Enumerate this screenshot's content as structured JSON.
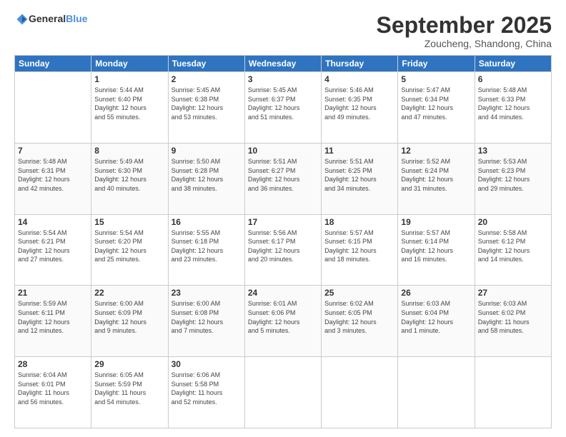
{
  "logo": {
    "text_general": "General",
    "text_blue": "Blue"
  },
  "title": "September 2025",
  "subtitle": "Zoucheng, Shandong, China",
  "days_header": [
    "Sunday",
    "Monday",
    "Tuesday",
    "Wednesday",
    "Thursday",
    "Friday",
    "Saturday"
  ],
  "weeks": [
    [
      {
        "num": "",
        "info": ""
      },
      {
        "num": "1",
        "info": "Sunrise: 5:44 AM\nSunset: 6:40 PM\nDaylight: 12 hours\nand 55 minutes."
      },
      {
        "num": "2",
        "info": "Sunrise: 5:45 AM\nSunset: 6:38 PM\nDaylight: 12 hours\nand 53 minutes."
      },
      {
        "num": "3",
        "info": "Sunrise: 5:45 AM\nSunset: 6:37 PM\nDaylight: 12 hours\nand 51 minutes."
      },
      {
        "num": "4",
        "info": "Sunrise: 5:46 AM\nSunset: 6:35 PM\nDaylight: 12 hours\nand 49 minutes."
      },
      {
        "num": "5",
        "info": "Sunrise: 5:47 AM\nSunset: 6:34 PM\nDaylight: 12 hours\nand 47 minutes."
      },
      {
        "num": "6",
        "info": "Sunrise: 5:48 AM\nSunset: 6:33 PM\nDaylight: 12 hours\nand 44 minutes."
      }
    ],
    [
      {
        "num": "7",
        "info": "Sunrise: 5:48 AM\nSunset: 6:31 PM\nDaylight: 12 hours\nand 42 minutes."
      },
      {
        "num": "8",
        "info": "Sunrise: 5:49 AM\nSunset: 6:30 PM\nDaylight: 12 hours\nand 40 minutes."
      },
      {
        "num": "9",
        "info": "Sunrise: 5:50 AM\nSunset: 6:28 PM\nDaylight: 12 hours\nand 38 minutes."
      },
      {
        "num": "10",
        "info": "Sunrise: 5:51 AM\nSunset: 6:27 PM\nDaylight: 12 hours\nand 36 minutes."
      },
      {
        "num": "11",
        "info": "Sunrise: 5:51 AM\nSunset: 6:25 PM\nDaylight: 12 hours\nand 34 minutes."
      },
      {
        "num": "12",
        "info": "Sunrise: 5:52 AM\nSunset: 6:24 PM\nDaylight: 12 hours\nand 31 minutes."
      },
      {
        "num": "13",
        "info": "Sunrise: 5:53 AM\nSunset: 6:23 PM\nDaylight: 12 hours\nand 29 minutes."
      }
    ],
    [
      {
        "num": "14",
        "info": "Sunrise: 5:54 AM\nSunset: 6:21 PM\nDaylight: 12 hours\nand 27 minutes."
      },
      {
        "num": "15",
        "info": "Sunrise: 5:54 AM\nSunset: 6:20 PM\nDaylight: 12 hours\nand 25 minutes."
      },
      {
        "num": "16",
        "info": "Sunrise: 5:55 AM\nSunset: 6:18 PM\nDaylight: 12 hours\nand 23 minutes."
      },
      {
        "num": "17",
        "info": "Sunrise: 5:56 AM\nSunset: 6:17 PM\nDaylight: 12 hours\nand 20 minutes."
      },
      {
        "num": "18",
        "info": "Sunrise: 5:57 AM\nSunset: 6:15 PM\nDaylight: 12 hours\nand 18 minutes."
      },
      {
        "num": "19",
        "info": "Sunrise: 5:57 AM\nSunset: 6:14 PM\nDaylight: 12 hours\nand 16 minutes."
      },
      {
        "num": "20",
        "info": "Sunrise: 5:58 AM\nSunset: 6:12 PM\nDaylight: 12 hours\nand 14 minutes."
      }
    ],
    [
      {
        "num": "21",
        "info": "Sunrise: 5:59 AM\nSunset: 6:11 PM\nDaylight: 12 hours\nand 12 minutes."
      },
      {
        "num": "22",
        "info": "Sunrise: 6:00 AM\nSunset: 6:09 PM\nDaylight: 12 hours\nand 9 minutes."
      },
      {
        "num": "23",
        "info": "Sunrise: 6:00 AM\nSunset: 6:08 PM\nDaylight: 12 hours\nand 7 minutes."
      },
      {
        "num": "24",
        "info": "Sunrise: 6:01 AM\nSunset: 6:06 PM\nDaylight: 12 hours\nand 5 minutes."
      },
      {
        "num": "25",
        "info": "Sunrise: 6:02 AM\nSunset: 6:05 PM\nDaylight: 12 hours\nand 3 minutes."
      },
      {
        "num": "26",
        "info": "Sunrise: 6:03 AM\nSunset: 6:04 PM\nDaylight: 12 hours\nand 1 minute."
      },
      {
        "num": "27",
        "info": "Sunrise: 6:03 AM\nSunset: 6:02 PM\nDaylight: 11 hours\nand 58 minutes."
      }
    ],
    [
      {
        "num": "28",
        "info": "Sunrise: 6:04 AM\nSunset: 6:01 PM\nDaylight: 11 hours\nand 56 minutes."
      },
      {
        "num": "29",
        "info": "Sunrise: 6:05 AM\nSunset: 5:59 PM\nDaylight: 11 hours\nand 54 minutes."
      },
      {
        "num": "30",
        "info": "Sunrise: 6:06 AM\nSunset: 5:58 PM\nDaylight: 11 hours\nand 52 minutes."
      },
      {
        "num": "",
        "info": ""
      },
      {
        "num": "",
        "info": ""
      },
      {
        "num": "",
        "info": ""
      },
      {
        "num": "",
        "info": ""
      }
    ]
  ]
}
